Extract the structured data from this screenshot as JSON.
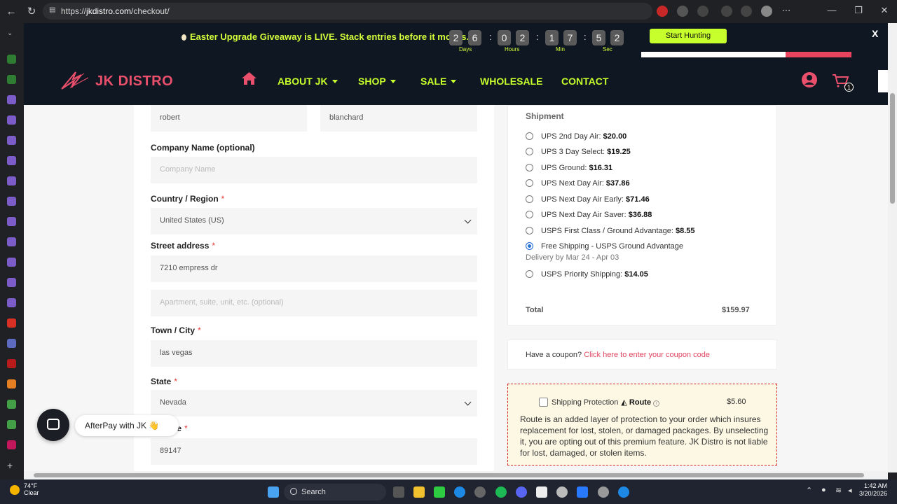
{
  "browser": {
    "url_prefix": "https://",
    "url_host": "jkdistro.com",
    "url_path": "/checkout/"
  },
  "promo": {
    "message": "Easter Upgrade Giveaway is LIVE. Stack entries before it moves.",
    "countdown": {
      "days": [
        "2",
        "6"
      ],
      "hours": [
        "0",
        "2"
      ],
      "min": [
        "1",
        "7"
      ],
      "sec": [
        "5",
        "2"
      ],
      "labels": {
        "days": "Days",
        "hours": "Hours",
        "min": "Min",
        "sec": "Sec"
      },
      "separator": ":"
    },
    "button_label": "Start Hunting",
    "close_label": "X"
  },
  "header": {
    "logo_text": "JK DISTRO",
    "menu": {
      "about": "ABOUT JK",
      "shop": "SHOP",
      "sale": "SALE",
      "wholesale": "WHOLESALE",
      "contact": "CONTACT"
    },
    "cart_count": "1"
  },
  "form": {
    "first_name": "robert",
    "last_name": "blanchard",
    "company_label": "Company Name (optional)",
    "company_placeholder": "Company Name",
    "country_label": "Country / Region",
    "country_value": "United States (US)",
    "street_label": "Street address",
    "street_value": "7210 empress dr",
    "apt_placeholder": "Apartment, suite, unit, etc. (optional)",
    "city_label": "Town / City",
    "city_value": "las vegas",
    "state_label": "State",
    "state_value": "Nevada",
    "zip_label_visible": "de",
    "zip_value": "89147",
    "required_mark": "*"
  },
  "shipment": {
    "title": "Shipment",
    "options": [
      {
        "name": "UPS 2nd Day Air:",
        "price": "$20.00",
        "selected": false
      },
      {
        "name": "UPS 3 Day Select:",
        "price": "$19.25",
        "selected": false
      },
      {
        "name": "UPS Ground:",
        "price": "$16.31",
        "selected": false
      },
      {
        "name": "UPS Next Day Air:",
        "price": "$37.86",
        "selected": false
      },
      {
        "name": "UPS Next Day Air Early:",
        "price": "$71.46",
        "selected": false
      },
      {
        "name": "UPS Next Day Air Saver:",
        "price": "$36.88",
        "selected": false
      },
      {
        "name": "USPS First Class / Ground Advantage:",
        "price": "$8.55",
        "selected": false
      },
      {
        "name": "Free Shipping - USPS Ground Advantage",
        "price": "",
        "selected": true
      },
      {
        "name": "USPS Priority Shipping:",
        "price": "$14.05",
        "selected": false
      }
    ],
    "delivery_note": "Delivery by Mar 24 - Apr 03",
    "total_label": "Total",
    "total_value": "$159.97"
  },
  "coupon": {
    "prompt": "Have a coupon?",
    "link": "Click here to enter your coupon code"
  },
  "route": {
    "label": "Shipping Protection",
    "brand": "Route",
    "info": "i",
    "price": "$5.60",
    "description": "Route is an added layer of protection to your order which insures replacement for lost, stolen, or damaged packages. By unselecting it, you are opting out of this premium feature. JK Distro is not liable for lost, damaged, or stolen items."
  },
  "chat": {
    "label": "AfterPay with JK",
    "emoji": "👋"
  },
  "taskbar": {
    "temp": "74°F",
    "condition": "Clear",
    "search": "Search",
    "time": "1:42 AM",
    "date": "3/20/2026"
  },
  "colors": {
    "accent_lime": "#c6ff2b",
    "brand_pink": "#ea4f6c",
    "header_bg": "#0f1722",
    "route_border": "#d21f1f"
  }
}
